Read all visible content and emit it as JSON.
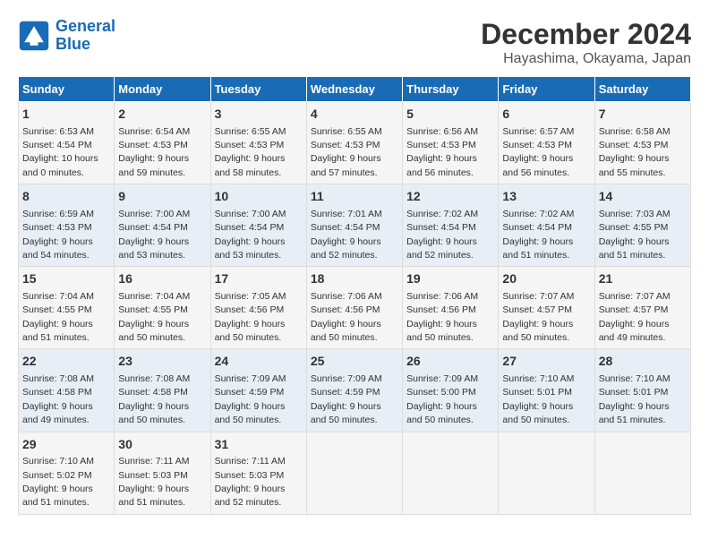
{
  "logo": {
    "text_general": "General",
    "text_blue": "Blue"
  },
  "title": "December 2024",
  "subtitle": "Hayashima, Okayama, Japan",
  "weekdays": [
    "Sunday",
    "Monday",
    "Tuesday",
    "Wednesday",
    "Thursday",
    "Friday",
    "Saturday"
  ],
  "weeks": [
    [
      {
        "day": "1",
        "sunrise": "6:53 AM",
        "sunset": "4:54 PM",
        "daylight": "10 hours and 0 minutes."
      },
      {
        "day": "2",
        "sunrise": "6:54 AM",
        "sunset": "4:53 PM",
        "daylight": "9 hours and 59 minutes."
      },
      {
        "day": "3",
        "sunrise": "6:55 AM",
        "sunset": "4:53 PM",
        "daylight": "9 hours and 58 minutes."
      },
      {
        "day": "4",
        "sunrise": "6:55 AM",
        "sunset": "4:53 PM",
        "daylight": "9 hours and 57 minutes."
      },
      {
        "day": "5",
        "sunrise": "6:56 AM",
        "sunset": "4:53 PM",
        "daylight": "9 hours and 56 minutes."
      },
      {
        "day": "6",
        "sunrise": "6:57 AM",
        "sunset": "4:53 PM",
        "daylight": "9 hours and 56 minutes."
      },
      {
        "day": "7",
        "sunrise": "6:58 AM",
        "sunset": "4:53 PM",
        "daylight": "9 hours and 55 minutes."
      }
    ],
    [
      {
        "day": "8",
        "sunrise": "6:59 AM",
        "sunset": "4:53 PM",
        "daylight": "9 hours and 54 minutes."
      },
      {
        "day": "9",
        "sunrise": "7:00 AM",
        "sunset": "4:54 PM",
        "daylight": "9 hours and 53 minutes."
      },
      {
        "day": "10",
        "sunrise": "7:00 AM",
        "sunset": "4:54 PM",
        "daylight": "9 hours and 53 minutes."
      },
      {
        "day": "11",
        "sunrise": "7:01 AM",
        "sunset": "4:54 PM",
        "daylight": "9 hours and 52 minutes."
      },
      {
        "day": "12",
        "sunrise": "7:02 AM",
        "sunset": "4:54 PM",
        "daylight": "9 hours and 52 minutes."
      },
      {
        "day": "13",
        "sunrise": "7:02 AM",
        "sunset": "4:54 PM",
        "daylight": "9 hours and 51 minutes."
      },
      {
        "day": "14",
        "sunrise": "7:03 AM",
        "sunset": "4:55 PM",
        "daylight": "9 hours and 51 minutes."
      }
    ],
    [
      {
        "day": "15",
        "sunrise": "7:04 AM",
        "sunset": "4:55 PM",
        "daylight": "9 hours and 51 minutes."
      },
      {
        "day": "16",
        "sunrise": "7:04 AM",
        "sunset": "4:55 PM",
        "daylight": "9 hours and 50 minutes."
      },
      {
        "day": "17",
        "sunrise": "7:05 AM",
        "sunset": "4:56 PM",
        "daylight": "9 hours and 50 minutes."
      },
      {
        "day": "18",
        "sunrise": "7:06 AM",
        "sunset": "4:56 PM",
        "daylight": "9 hours and 50 minutes."
      },
      {
        "day": "19",
        "sunrise": "7:06 AM",
        "sunset": "4:56 PM",
        "daylight": "9 hours and 50 minutes."
      },
      {
        "day": "20",
        "sunrise": "7:07 AM",
        "sunset": "4:57 PM",
        "daylight": "9 hours and 50 minutes."
      },
      {
        "day": "21",
        "sunrise": "7:07 AM",
        "sunset": "4:57 PM",
        "daylight": "9 hours and 49 minutes."
      }
    ],
    [
      {
        "day": "22",
        "sunrise": "7:08 AM",
        "sunset": "4:58 PM",
        "daylight": "9 hours and 49 minutes."
      },
      {
        "day": "23",
        "sunrise": "7:08 AM",
        "sunset": "4:58 PM",
        "daylight": "9 hours and 50 minutes."
      },
      {
        "day": "24",
        "sunrise": "7:09 AM",
        "sunset": "4:59 PM",
        "daylight": "9 hours and 50 minutes."
      },
      {
        "day": "25",
        "sunrise": "7:09 AM",
        "sunset": "4:59 PM",
        "daylight": "9 hours and 50 minutes."
      },
      {
        "day": "26",
        "sunrise": "7:09 AM",
        "sunset": "5:00 PM",
        "daylight": "9 hours and 50 minutes."
      },
      {
        "day": "27",
        "sunrise": "7:10 AM",
        "sunset": "5:01 PM",
        "daylight": "9 hours and 50 minutes."
      },
      {
        "day": "28",
        "sunrise": "7:10 AM",
        "sunset": "5:01 PM",
        "daylight": "9 hours and 51 minutes."
      }
    ],
    [
      {
        "day": "29",
        "sunrise": "7:10 AM",
        "sunset": "5:02 PM",
        "daylight": "9 hours and 51 minutes."
      },
      {
        "day": "30",
        "sunrise": "7:11 AM",
        "sunset": "5:03 PM",
        "daylight": "9 hours and 51 minutes."
      },
      {
        "day": "31",
        "sunrise": "7:11 AM",
        "sunset": "5:03 PM",
        "daylight": "9 hours and 52 minutes."
      },
      null,
      null,
      null,
      null
    ]
  ]
}
